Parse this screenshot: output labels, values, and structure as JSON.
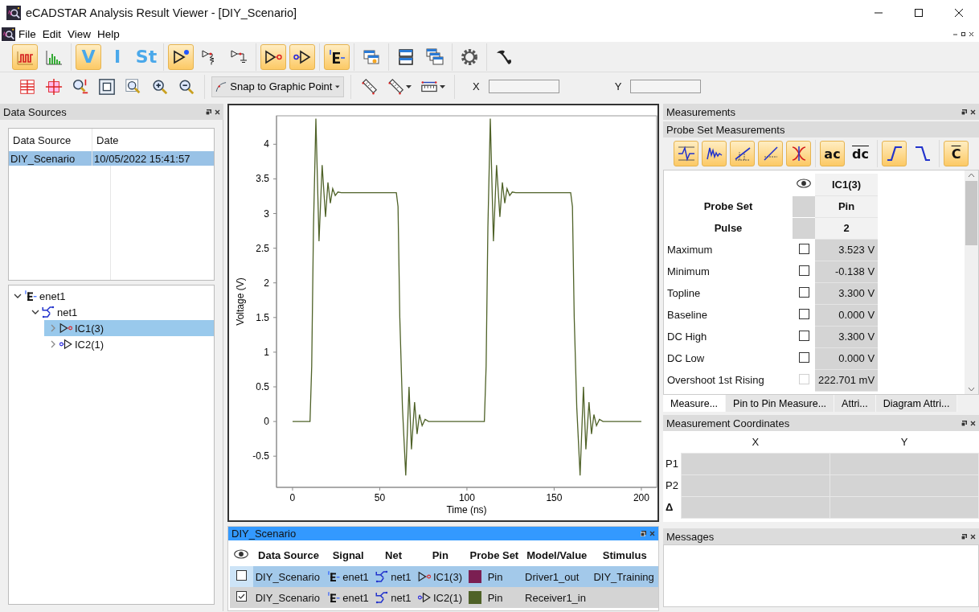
{
  "window": {
    "title": "eCADSTAR Analysis Result Viewer - [DIY_Scenario]"
  },
  "menu": [
    {
      "label": "File"
    },
    {
      "label": "Edit"
    },
    {
      "label": "View"
    },
    {
      "label": "Help"
    }
  ],
  "toolbar": [
    [
      {
        "kind": "time",
        "on": true
      },
      {
        "kind": "freq",
        "on": false
      }
    ],
    [
      {
        "kind": "text",
        "label": "V",
        "on": true
      },
      {
        "kind": "text",
        "label": "I",
        "on": false
      },
      {
        "kind": "text",
        "label": "St",
        "on": false
      }
    ],
    [
      {
        "kind": "probe",
        "on": true
      },
      {
        "kind": "probe-res",
        "on": false
      },
      {
        "kind": "probe-gnd",
        "on": false
      }
    ],
    [
      {
        "kind": "driver",
        "on": true
      },
      {
        "kind": "receiver",
        "on": true
      }
    ],
    [
      {
        "kind": "enet",
        "on": true
      }
    ],
    [
      {
        "kind": "window-star",
        "on": false
      }
    ],
    [
      {
        "kind": "tile",
        "on": false
      },
      {
        "kind": "cascade",
        "on": false
      }
    ],
    [
      {
        "kind": "gear",
        "on": false
      }
    ],
    [
      {
        "kind": "phone",
        "on": false
      }
    ]
  ],
  "snap": {
    "value": "Snap to Graphic Point"
  },
  "coordinates": [
    {
      "label": "X"
    },
    {
      "label": "Y"
    }
  ],
  "data_sources": {
    "title": "Data Sources",
    "active": false,
    "columns": [
      "Data Source",
      "Date"
    ],
    "rows": [
      {
        "cells": [
          "DIY_Scenario",
          "10/05/2022 15:41:57"
        ],
        "selected": true
      }
    ]
  },
  "tree": [
    {
      "kind": "enet",
      "label": "enet1",
      "expanded": true,
      "selected": false,
      "children": [
        {
          "kind": "net",
          "label": "net1",
          "expanded": true,
          "selected": false,
          "children": [
            {
              "kind": "driver",
              "label": "IC1(3)",
              "expanded": false,
              "selected": true
            },
            {
              "kind": "receiver",
              "label": "IC2(1)",
              "expanded": false,
              "selected": false
            }
          ]
        }
      ]
    }
  ],
  "waveform": {
    "chart_data": {
      "type": "line",
      "xlabel": "Time (ns)",
      "ylabel": "Voltage (V)",
      "x": [
        0,
        10,
        11,
        12,
        13.4,
        15.2,
        17,
        18.9,
        20.3,
        21.7,
        23,
        24.5,
        26,
        28,
        59.5,
        60.5,
        61.5,
        63,
        64.9,
        66.8,
        68.2,
        70,
        71.4,
        72.8,
        74.3,
        76,
        78,
        110,
        111,
        112,
        113.4,
        115.2,
        117,
        118.9,
        120.3,
        121.7,
        123,
        124.5,
        126,
        128,
        159.5,
        160.5,
        161.5,
        163,
        164.9,
        166.8,
        168.2,
        170,
        171.4,
        172.8,
        174.3,
        176,
        178,
        200
      ],
      "series": [
        {
          "color": "#4f6228",
          "values": [
            0,
            0,
            0.8,
            2.8,
            4.37,
            2.6,
            3.7,
            2.95,
            3.45,
            3.15,
            3.36,
            3.26,
            3.31,
            3.3,
            3.3,
            3.1,
            1.5,
            0.2,
            -0.78,
            0.5,
            -0.4,
            0.28,
            -0.18,
            0.1,
            -0.06,
            0.03,
            0,
            0,
            0.8,
            2.8,
            4.37,
            2.6,
            3.7,
            2.95,
            3.45,
            3.15,
            3.36,
            3.26,
            3.31,
            3.3,
            3.3,
            3.1,
            1.5,
            0.2,
            -0.78,
            0.5,
            -0.4,
            0.28,
            -0.18,
            0.1,
            -0.06,
            0.03,
            0,
            0
          ]
        }
      ],
      "xlim": [
        -9.2,
        208.8
      ],
      "ylim": [
        -0.95,
        4.41
      ],
      "xticks": [
        0,
        50,
        100,
        150,
        200
      ],
      "yticks": [
        -0.5,
        0,
        0.5,
        1,
        1.5,
        2,
        2.5,
        3,
        3.5,
        4
      ]
    }
  },
  "signals_panel": {
    "title": "DIY_Scenario",
    "active": true,
    "columns": [
      "Data Source",
      "Signal",
      "Net",
      "Pin",
      "Probe Set",
      "Model/Value",
      "Stimulus"
    ],
    "rows": [
      {
        "checked": false,
        "selected": true,
        "data_source": "DIY_Scenario",
        "signal": "enet1",
        "net": "net1",
        "pin": {
          "kind": "driver",
          "label": "IC1(3)"
        },
        "probe_set": {
          "color": "#7b1f52",
          "label": "Pin"
        },
        "model": "Driver1_out",
        "stimulus": "DIY_Training"
      },
      {
        "checked": true,
        "selected": false,
        "data_source": "DIY_Scenario",
        "signal": "enet1",
        "net": "net1",
        "pin": {
          "kind": "receiver",
          "label": "IC2(1)"
        },
        "probe_set": {
          "color": "#4f6228",
          "label": "Pin"
        },
        "model": "Receiver1_in"
      }
    ]
  },
  "measurements": {
    "title": "Measurements",
    "active": false,
    "subtitle": "Probe Set Measurements",
    "tools": [
      [
        {
          "kind": "ringing",
          "on": true
        },
        {
          "kind": "noise",
          "on": true
        },
        {
          "kind": "slope-a",
          "on": true
        },
        {
          "kind": "slope-b",
          "on": true
        },
        {
          "kind": "crossing",
          "on": true
        }
      ],
      [
        {
          "kind": "text",
          "label": "ac",
          "overline": false,
          "on": true
        },
        {
          "kind": "text",
          "label": "dc",
          "overline": true,
          "on": false
        }
      ],
      [
        {
          "kind": "rise",
          "on": true
        },
        {
          "kind": "fall",
          "on": false
        }
      ],
      [
        {
          "kind": "text",
          "label": "C",
          "overline": true,
          "on": true
        }
      ]
    ],
    "column": "IC1(3)",
    "header_rows": [
      {
        "label": "Probe Set",
        "value": "Pin"
      },
      {
        "label": "Pulse",
        "value": "2"
      }
    ],
    "rows": [
      {
        "name": "Maximum",
        "checked": false,
        "disabled": false,
        "value": "3.523 V"
      },
      {
        "name": "Minimum",
        "checked": false,
        "disabled": false,
        "value": "-0.138 V"
      },
      {
        "name": "Topline",
        "checked": false,
        "disabled": false,
        "value": "3.300 V"
      },
      {
        "name": "Baseline",
        "checked": false,
        "disabled": false,
        "value": "0.000 V"
      },
      {
        "name": "DC High",
        "checked": false,
        "disabled": false,
        "value": "3.300 V"
      },
      {
        "name": "DC Low",
        "checked": false,
        "disabled": false,
        "value": "0.000 V"
      },
      {
        "name": "Overshoot 1st Rising",
        "checked": false,
        "disabled": true,
        "value": "222.701 mV"
      }
    ],
    "tabs": [
      {
        "label": "Measure...",
        "selected": true
      },
      {
        "label": "Pin to Pin Measure...",
        "selected": false
      },
      {
        "label": "Attri...",
        "selected": false
      },
      {
        "label": "Diagram Attri...",
        "selected": false
      }
    ]
  },
  "coordinates_panel": {
    "title": "Measurement Coordinates",
    "active": false,
    "columns": [
      "X",
      "Y"
    ],
    "rows": [
      "P1",
      "P2",
      "Δ"
    ]
  },
  "messages": {
    "title": "Messages",
    "active": false
  }
}
